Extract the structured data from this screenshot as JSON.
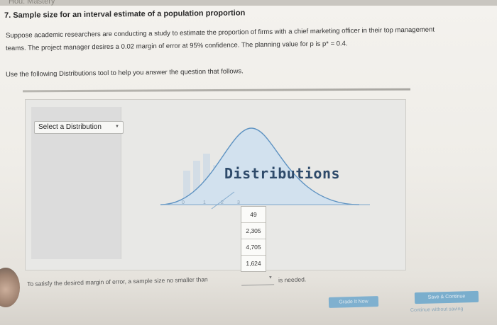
{
  "header": {
    "strip_text": "Hou: Mastery",
    "question_title": "7. Sample size for an interval estimate of a population proportion"
  },
  "body": {
    "paragraph1": "Suppose academic researchers are conducting a study to estimate the proportion of firms with a chief marketing officer in their top management",
    "paragraph2": "teams. The project manager desires a 0.02 margin of error at 95% confidence. The planning value for p is p* = 0.4.",
    "paragraph3": "Use the following Distributions tool to help you answer the question that follows."
  },
  "tool": {
    "select_label": "Select a Distribution",
    "title": "Distributions",
    "ticks": [
      "0",
      "1",
      "2",
      "3"
    ]
  },
  "dropdown": {
    "options": [
      "49",
      "2,305",
      "4,705",
      "1,624"
    ]
  },
  "answer": {
    "sentence": "To satisfy the desired margin of error, a sample size no smaller than",
    "suffix": "is needed."
  },
  "buttons": {
    "grade": "Grade It Now",
    "save": "Save & Continue",
    "continue": "Continue without saving"
  },
  "colors": {
    "button_blue": "#7fb0cf",
    "curve_blue": "#5f93c2",
    "title_blue": "#2e4a6a"
  }
}
